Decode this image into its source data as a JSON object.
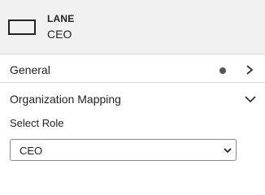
{
  "header": {
    "icon": "rectangle-icon",
    "title": "LANE",
    "subtitle": "CEO"
  },
  "sections": {
    "general": {
      "label": "General",
      "status_icon": "dot-icon",
      "chevron_icon": "chevron-right-icon",
      "expanded": false
    },
    "organization_mapping": {
      "label": "Organization Mapping",
      "chevron_icon": "chevron-down-icon",
      "expanded": true,
      "select_role": {
        "label": "Select Role",
        "value": "CEO",
        "caret_icon": "caret-down-icon"
      }
    }
  },
  "colors": {
    "header_bg": "#f1f1f1",
    "text": "#222222",
    "divider": "#d6d6d6"
  }
}
